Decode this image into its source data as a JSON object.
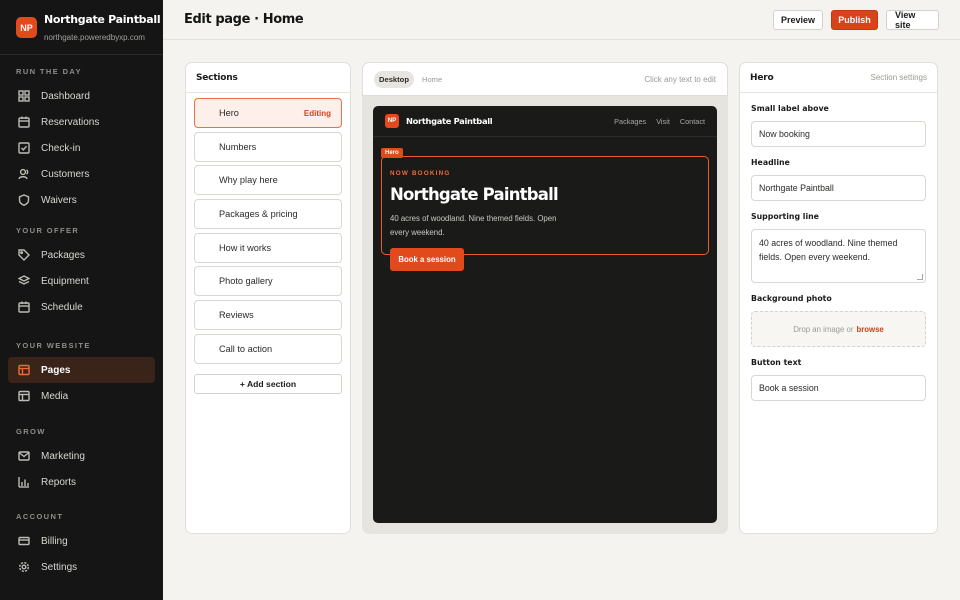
{
  "brand": {
    "logo_text": "NP",
    "name": "Northgate Paintball",
    "url": "northgate.poweredbyxp.com"
  },
  "sidebar": {
    "groups": [
      {
        "heading": "RUN THE DAY",
        "items": [
          {
            "label": "Dashboard",
            "icon": "dashboard-icon"
          },
          {
            "label": "Reservations",
            "icon": "calendar-icon"
          },
          {
            "label": "Check-in",
            "icon": "checkbox-icon"
          },
          {
            "label": "Customers",
            "icon": "user-icon"
          },
          {
            "label": "Waivers",
            "icon": "shield-icon"
          }
        ]
      },
      {
        "heading": "YOUR OFFER",
        "items": [
          {
            "label": "Packages",
            "icon": "tag-icon"
          },
          {
            "label": "Equipment",
            "icon": "layers-icon"
          },
          {
            "label": "Schedule",
            "icon": "calendar-icon"
          }
        ]
      },
      {
        "heading": "YOUR WEBSITE",
        "items": [
          {
            "label": "Pages",
            "icon": "layout-icon",
            "active": true
          },
          {
            "label": "Media",
            "icon": "layout-icon"
          }
        ]
      },
      {
        "heading": "GROW",
        "items": [
          {
            "label": "Marketing",
            "icon": "mail-icon"
          },
          {
            "label": "Reports",
            "icon": "bar-chart-icon"
          }
        ]
      },
      {
        "heading": "ACCOUNT",
        "items": [
          {
            "label": "Billing",
            "icon": "card-icon"
          },
          {
            "label": "Settings",
            "icon": "gear-icon"
          }
        ]
      }
    ]
  },
  "header": {
    "title": "Edit page · Home",
    "preview_label": "Preview",
    "publish_label": "Publish",
    "view_site_label": "View site"
  },
  "sections_panel": {
    "title": "Sections",
    "items": [
      "Hero",
      "Numbers",
      "Why play here",
      "Packages & pricing",
      "How it works",
      "Photo gallery",
      "Reviews",
      "Call to action"
    ],
    "editing_label": "Editing",
    "add_label": "+ Add section"
  },
  "preview": {
    "tabs": [
      "Desktop",
      "Home"
    ],
    "hint": "Click any text to edit",
    "site": {
      "logo_text": "NP",
      "name": "Northgate Paintball",
      "links": [
        "Packages",
        "Visit",
        "Contact"
      ],
      "hero_tag": "Hero",
      "eyebrow": "NOW BOOKING",
      "title": "Northgate Paintball",
      "subtitle": "40 acres of woodland. Nine themed fields. Open every weekend.",
      "cta": "Book a session"
    }
  },
  "settings_panel": {
    "title": "Hero",
    "subtitle": "Section settings",
    "fields": {
      "small_label": {
        "label": "Small label above",
        "value": "Now booking"
      },
      "headline": {
        "label": "Headline",
        "value": "Northgate Paintball"
      },
      "supporting": {
        "label": "Supporting line",
        "value": "40 acres of woodland. Nine themed fields. Open every weekend."
      },
      "background": {
        "label": "Background photo",
        "drop_text": "Drop an image or",
        "browse_text": "browse"
      },
      "button": {
        "label": "Button text",
        "value": "Book a session"
      }
    }
  },
  "colors": {
    "accent": "#d8431a",
    "sidebar_bg": "#141514",
    "page_bg": "#f4f3ef"
  }
}
